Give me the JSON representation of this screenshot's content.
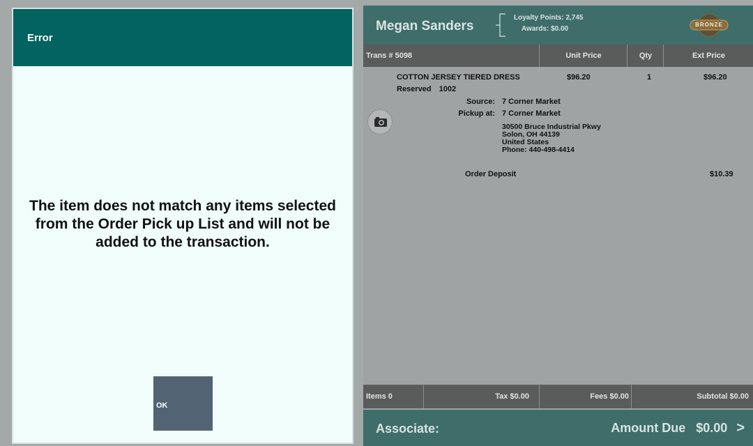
{
  "dialog": {
    "title": "Error",
    "message": "The item does not match any items selected from the Order Pick up List and will not be added to the transaction.",
    "ok_label": "OK"
  },
  "customer": {
    "name": "Megan Sanders",
    "loyalty_label": "Loyalty Points:",
    "loyalty_value": "2,745",
    "awards_label": "Awards:",
    "awards_value": "$0.00",
    "tier": "BRONZE"
  },
  "columns": {
    "trans": "Trans # 5098",
    "unit_price": "Unit Price",
    "qty": "Qty",
    "ext_price": "Ext Price"
  },
  "item": {
    "name": "COTTON JERSEY TIERED DRESS",
    "unit_price": "$96.20",
    "qty": "1",
    "ext_price": "$96.20",
    "reserved_label": "Reserved",
    "reserved_value": "1002",
    "source_label": "Source:",
    "source_value": "7 Corner Market",
    "pickup_label": "Pickup at:",
    "pickup_value": "7 Corner Market",
    "address": [
      "30500 Bruce Industrial Pkwy",
      "Solon, OH 44139",
      "United States",
      "Phone: 440-498-4414"
    ],
    "deposit_label": "Order Deposit",
    "deposit_value": "$10.39",
    "icon": "camera-icon"
  },
  "totals": {
    "items": "Items 0",
    "tax": "Tax $0.00",
    "fees": "Fees $0.00",
    "subtotal": "Subtotal $0.00"
  },
  "footer": {
    "associate": "Associate:",
    "amount_due_label": "Amount Due",
    "amount_due_value": "$0.00",
    "chevron": ">"
  },
  "colors": {
    "header_teal": "#026360",
    "panel_teal": "#3f6d6a",
    "ok_button": "#526374",
    "dialog_bg": "#f0fdfa"
  }
}
